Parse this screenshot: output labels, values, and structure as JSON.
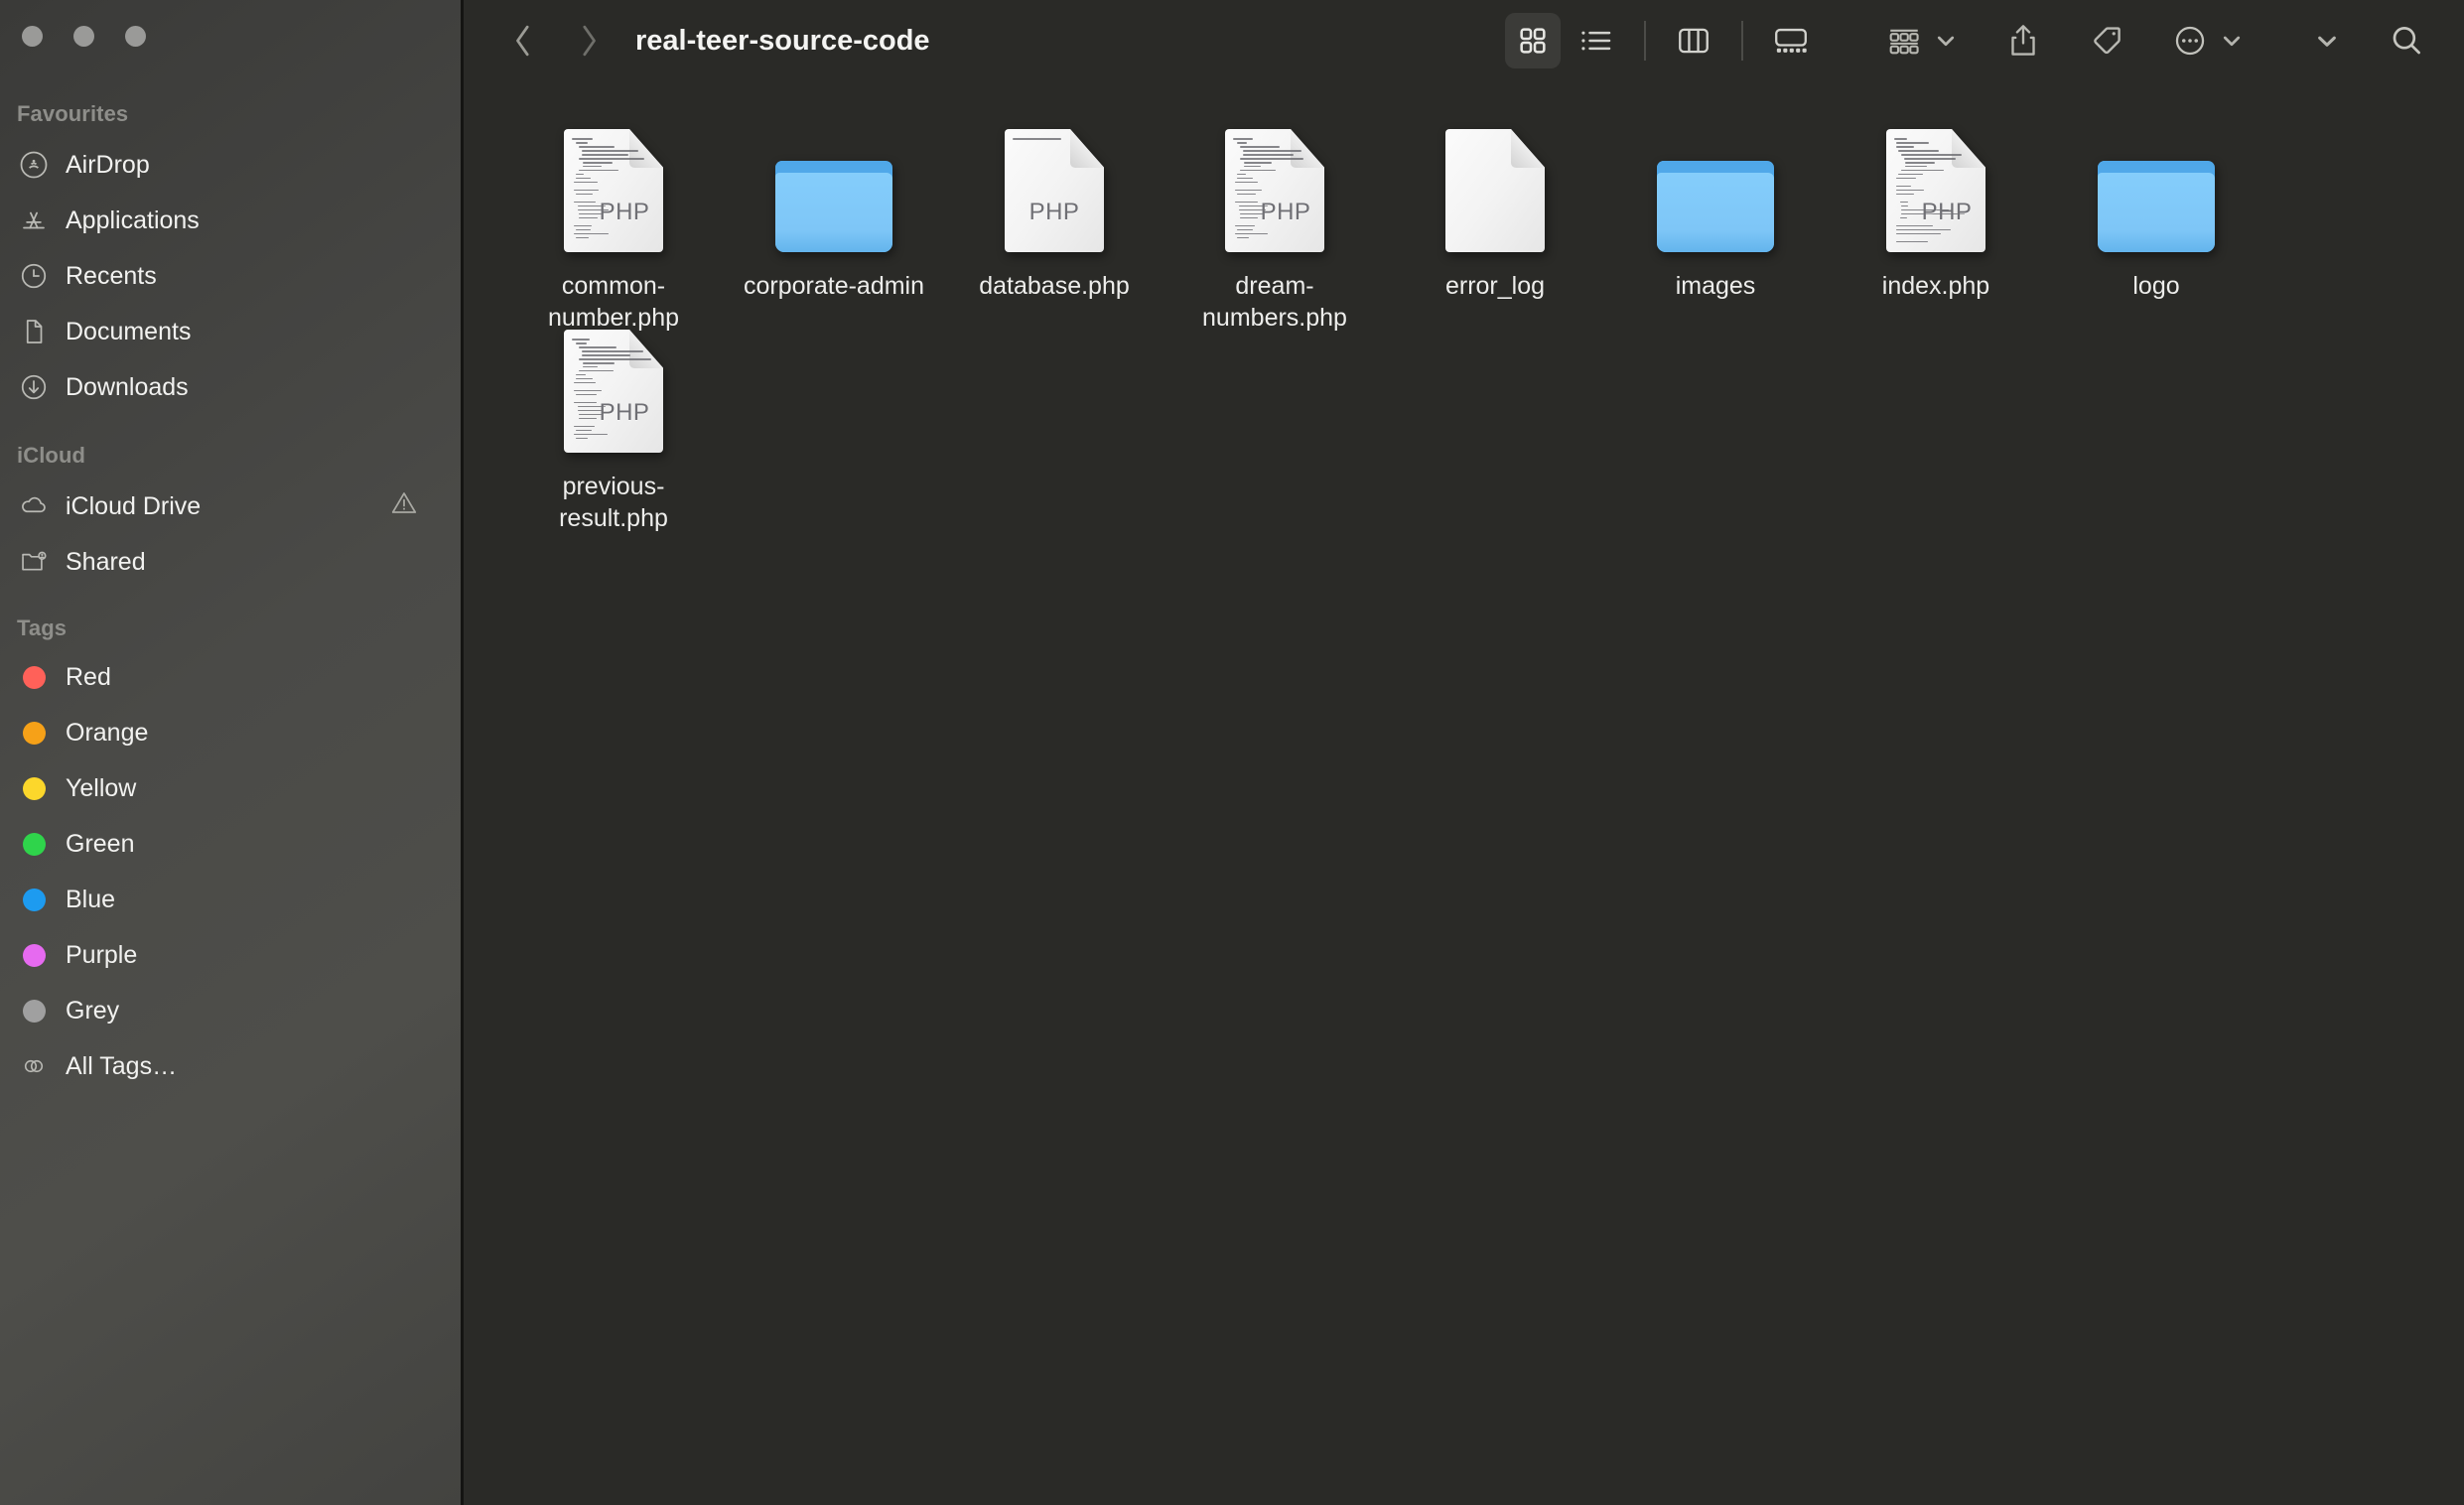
{
  "window": {
    "title": "real-teer-source-code",
    "traffic_lights": [
      "close-button",
      "minimize-button",
      "zoom-button"
    ]
  },
  "toolbar": {
    "back_label": "Back",
    "forward_label": "Forward",
    "views": [
      {
        "id": "icon",
        "label": "Icon View",
        "active": true
      },
      {
        "id": "list",
        "label": "List View",
        "active": false
      },
      {
        "id": "column",
        "label": "Column View",
        "active": false
      },
      {
        "id": "gallery",
        "label": "Gallery View",
        "active": false
      }
    ],
    "group_label": "Group Items",
    "share_label": "Share",
    "tag_label": "Edit Tags",
    "more_label": "More",
    "toolbar_overflow_label": "More Toolbar Items",
    "search_label": "Search"
  },
  "sidebar": {
    "sections": [
      {
        "title": "Favourites",
        "items": [
          {
            "label": "AirDrop",
            "icon": "airdrop-icon"
          },
          {
            "label": "Applications",
            "icon": "applications-icon"
          },
          {
            "label": "Recents",
            "icon": "clock-icon"
          },
          {
            "label": "Documents",
            "icon": "document-icon"
          },
          {
            "label": "Downloads",
            "icon": "download-icon"
          }
        ]
      },
      {
        "title": "iCloud",
        "items": [
          {
            "label": "iCloud Drive",
            "icon": "cloud-icon",
            "badge": "warning-icon"
          },
          {
            "label": "Shared",
            "icon": "shared-folder-icon"
          }
        ]
      },
      {
        "title": "Tags",
        "items": [
          {
            "label": "Red",
            "icon": "tag-dot-icon",
            "color": "#ff6159"
          },
          {
            "label": "Orange",
            "icon": "tag-dot-icon",
            "color": "#f6a118"
          },
          {
            "label": "Yellow",
            "icon": "tag-dot-icon",
            "color": "#fcd72b"
          },
          {
            "label": "Green",
            "icon": "tag-dot-icon",
            "color": "#2fd44b"
          },
          {
            "label": "Blue",
            "icon": "tag-dot-icon",
            "color": "#1d9bf0"
          },
          {
            "label": "Purple",
            "icon": "tag-dot-icon",
            "color": "#e66af0"
          },
          {
            "label": "Grey",
            "icon": "tag-dot-icon",
            "color": "#a0a0a0"
          },
          {
            "label": "All Tags…",
            "icon": "all-tags-icon"
          }
        ]
      }
    ]
  },
  "files": [
    {
      "name": "common-number.php",
      "kind": "php-file",
      "ext": "PHP",
      "code": "full"
    },
    {
      "name": "corporate-admin",
      "kind": "folder"
    },
    {
      "name": "database.php",
      "kind": "php-file",
      "ext": "PHP",
      "code": "sparse"
    },
    {
      "name": "dream-numbers.php",
      "kind": "php-file",
      "ext": "PHP",
      "code": "full"
    },
    {
      "name": "error_log",
      "kind": "blank-file",
      "ext": "",
      "code": "none"
    },
    {
      "name": "images",
      "kind": "folder"
    },
    {
      "name": "index.php",
      "kind": "php-file",
      "ext": "PHP",
      "code": "full"
    },
    {
      "name": "logo",
      "kind": "folder"
    },
    {
      "name": "previous-result.php",
      "kind": "php-file",
      "ext": "PHP",
      "code": "full"
    }
  ],
  "colors": {
    "window_bg": "#2a2a27",
    "sidebar_bg": "#46464300",
    "folder_blue": "#7ec6f7",
    "text": "#ededeb",
    "muted_text": "#8e8e8a"
  }
}
